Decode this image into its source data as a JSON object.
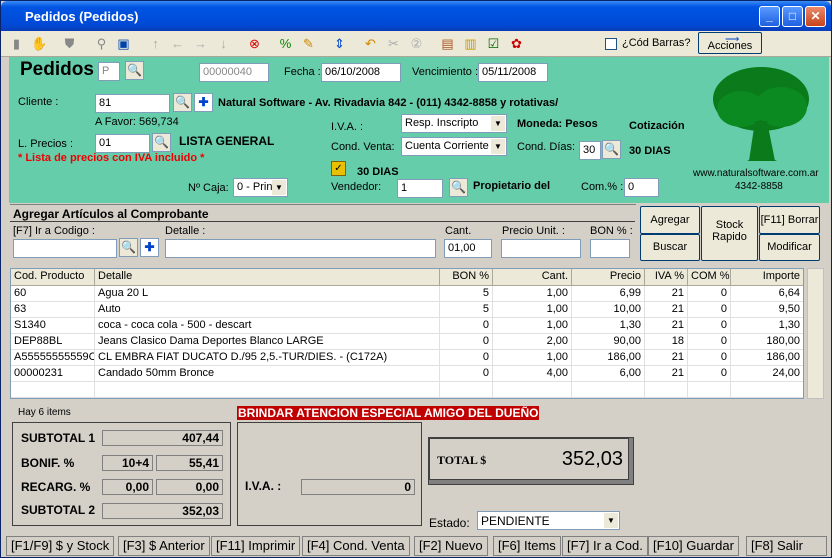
{
  "window": {
    "title": "Pedidos  (Pedidos)"
  },
  "toolbar": {
    "barcode_label": "¿Cód Barras?",
    "acciones": "Acciones"
  },
  "header": {
    "doc_title": "Pedidos",
    "doc_letter": "P",
    "doc_number": "00000040",
    "fecha_label": "Fecha :",
    "fecha": "06/10/2008",
    "venc_label": "Vencimiento :",
    "venc": "05/11/2008"
  },
  "cliente": {
    "label": "Cliente :",
    "code": "81",
    "name": "Natural Software - Av. Rivadavia 842 - (011)  4342-8858   y rotativas/",
    "a_favor": "A Favor: 569,734"
  },
  "precios": {
    "label": "L. Precios :",
    "code": "01",
    "name": "LISTA GENERAL",
    "note": "* Lista de precios con IVA incluido *"
  },
  "iva": {
    "label": "I.V.A. :",
    "value": "Resp. Inscripto",
    "moneda": "Moneda: Pesos",
    "cotizacion": "Cotización"
  },
  "venta": {
    "label": "Cond. Venta:",
    "value": "Cuenta Corriente",
    "dias_label": "Cond. Días:",
    "dias": "30",
    "dias_text": "30 DIAS",
    "dias_text2": "30 DIAS"
  },
  "caja": {
    "label": "Nº Caja:",
    "value": "0 - Prin"
  },
  "vendedor": {
    "label": "Vendedor:",
    "code": "1",
    "name": "Propietario del",
    "com_label": "Com.% :",
    "com": "0"
  },
  "logo": {
    "url": "www.naturalsoftware.com.ar",
    "phone": "4342-8858"
  },
  "add": {
    "title": "Agregar Artículos al Comprobante",
    "f7_label": "[F7] Ir a Codigo :",
    "detalle_label": "Detalle :",
    "cant_label": "Cant.",
    "cant": "01,00",
    "precio_label": "Precio Unit. :",
    "bon_label": "BON % :",
    "btn_agregar": "Agregar",
    "btn_buscar": "Buscar",
    "btn_stock": "Stock Rapido",
    "btn_borrar": "[F11] Borrar",
    "btn_modificar": "Modificar"
  },
  "grid": {
    "headers": [
      "Cod. Producto",
      "Detalle",
      "BON %",
      "Cant.",
      "Precio",
      "IVA %",
      "COM %",
      "Importe"
    ],
    "rows": [
      [
        "60",
        "Agua 20 L",
        "5",
        "1,00",
        "6,99",
        "21",
        "0",
        "6,64"
      ],
      [
        "63",
        "Auto",
        "5",
        "1,00",
        "10,00",
        "21",
        "0",
        "9,50"
      ],
      [
        "S1340",
        "coca - coca cola - 500 - descart",
        "0",
        "1,00",
        "1,30",
        "21",
        "0",
        "1,30"
      ],
      [
        "DEP88BL",
        "Jeans Clasico Dama Deportes Blanco LARGE",
        "0",
        "2,00",
        "90,00",
        "18",
        "0",
        "180,00"
      ],
      [
        "A55555555559C",
        "CL EMBRA FIAT DUCATO D./95 2,5.-TUR/DIES. - (C172A)",
        "0",
        "1,00",
        "186,00",
        "21",
        "0",
        "186,00"
      ],
      [
        "00000231",
        "Candado 50mm Bronce",
        "0",
        "4,00",
        "6,00",
        "21",
        "0",
        "24,00"
      ]
    ]
  },
  "summary": {
    "items": "Hay 6 items",
    "alert": "BRINDAR ATENCION ESPECIAL AMIGO DEL DUEÑO",
    "subtotal1_label": "SUBTOTAL 1",
    "subtotal1": "407,44",
    "bonif_label": "BONIF. %",
    "bonif_pct": "10+4",
    "bonif": "55,41",
    "recarg_label": "RECARG. %",
    "recarg_pct": "0,00",
    "recarg": "0,00",
    "subtotal2_label": "SUBTOTAL 2",
    "subtotal2": "352,03",
    "iva_label": "I.V.A. :",
    "iva": "0",
    "total_label": "TOTAL $",
    "total": "352,03",
    "estado_label": "Estado:",
    "estado": "PENDIENTE"
  },
  "fkeys": [
    "[F1/F9] $ y Stock",
    "[F3] $ Anterior",
    "[F11] Imprimir",
    "[F4] Cond. Venta",
    "[F2] Nuevo",
    "[F6] Items",
    "[F7] Ir a Cod.",
    "[F10] Guardar",
    "[F8] Salir"
  ]
}
